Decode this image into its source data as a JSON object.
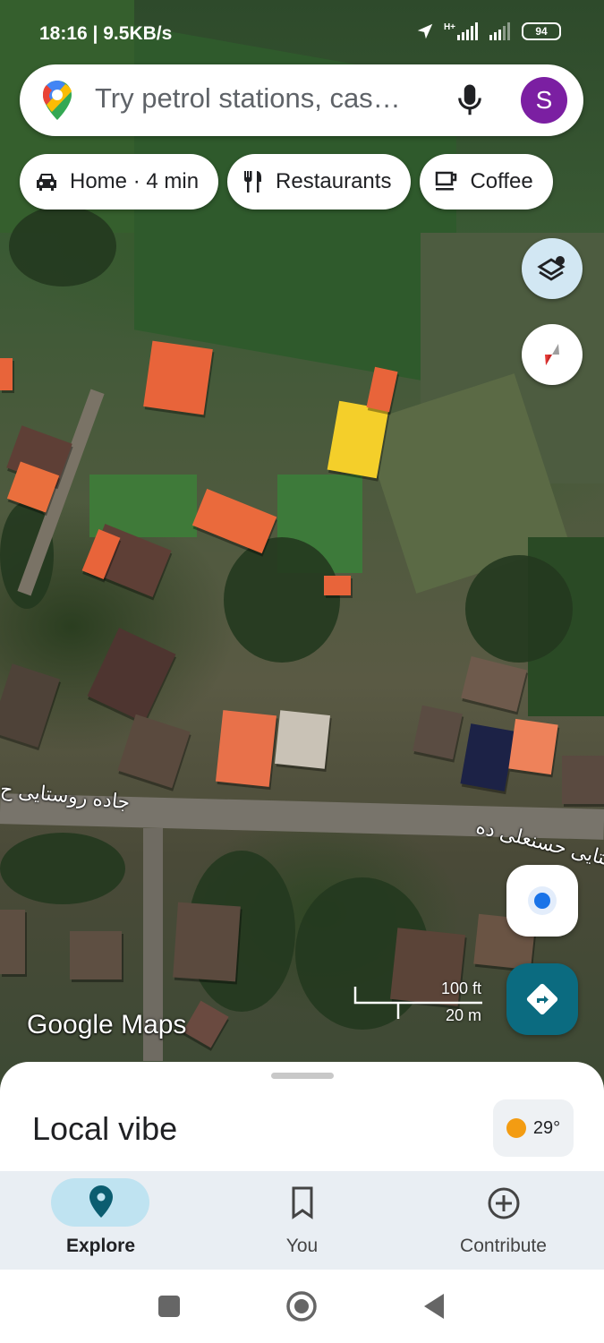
{
  "status_bar": {
    "time_speed": "18:16 | 9.5KB/s",
    "network": "H+",
    "battery": "94"
  },
  "search": {
    "placeholder": "Try petrol stations, cas…",
    "avatar_letter": "S"
  },
  "chips": [
    {
      "label": "Home · 4 min",
      "icon": "car-icon"
    },
    {
      "label": "Restaurants",
      "icon": "fork-knife-icon"
    },
    {
      "label": "Coffee",
      "icon": "coffee-cup-icon"
    }
  ],
  "map": {
    "road_label_1": "جاده روستایی ح",
    "road_label_2": "ستایی حسنعلی ده",
    "scale_imperial": "100 ft",
    "scale_metric": "20 m",
    "watermark": "Google Maps"
  },
  "sheet": {
    "title": "Local vibe",
    "temperature": "29°"
  },
  "bottom_nav": [
    {
      "label": "Explore",
      "icon": "explore-pin-icon",
      "active": true
    },
    {
      "label": "You",
      "icon": "bookmark-icon",
      "active": false
    },
    {
      "label": "Contribute",
      "icon": "add-circle-icon",
      "active": false
    }
  ],
  "colors": {
    "accent": "#0b6b80",
    "avatar": "#7b1fa2",
    "active_nav": "#bfe3f1"
  }
}
